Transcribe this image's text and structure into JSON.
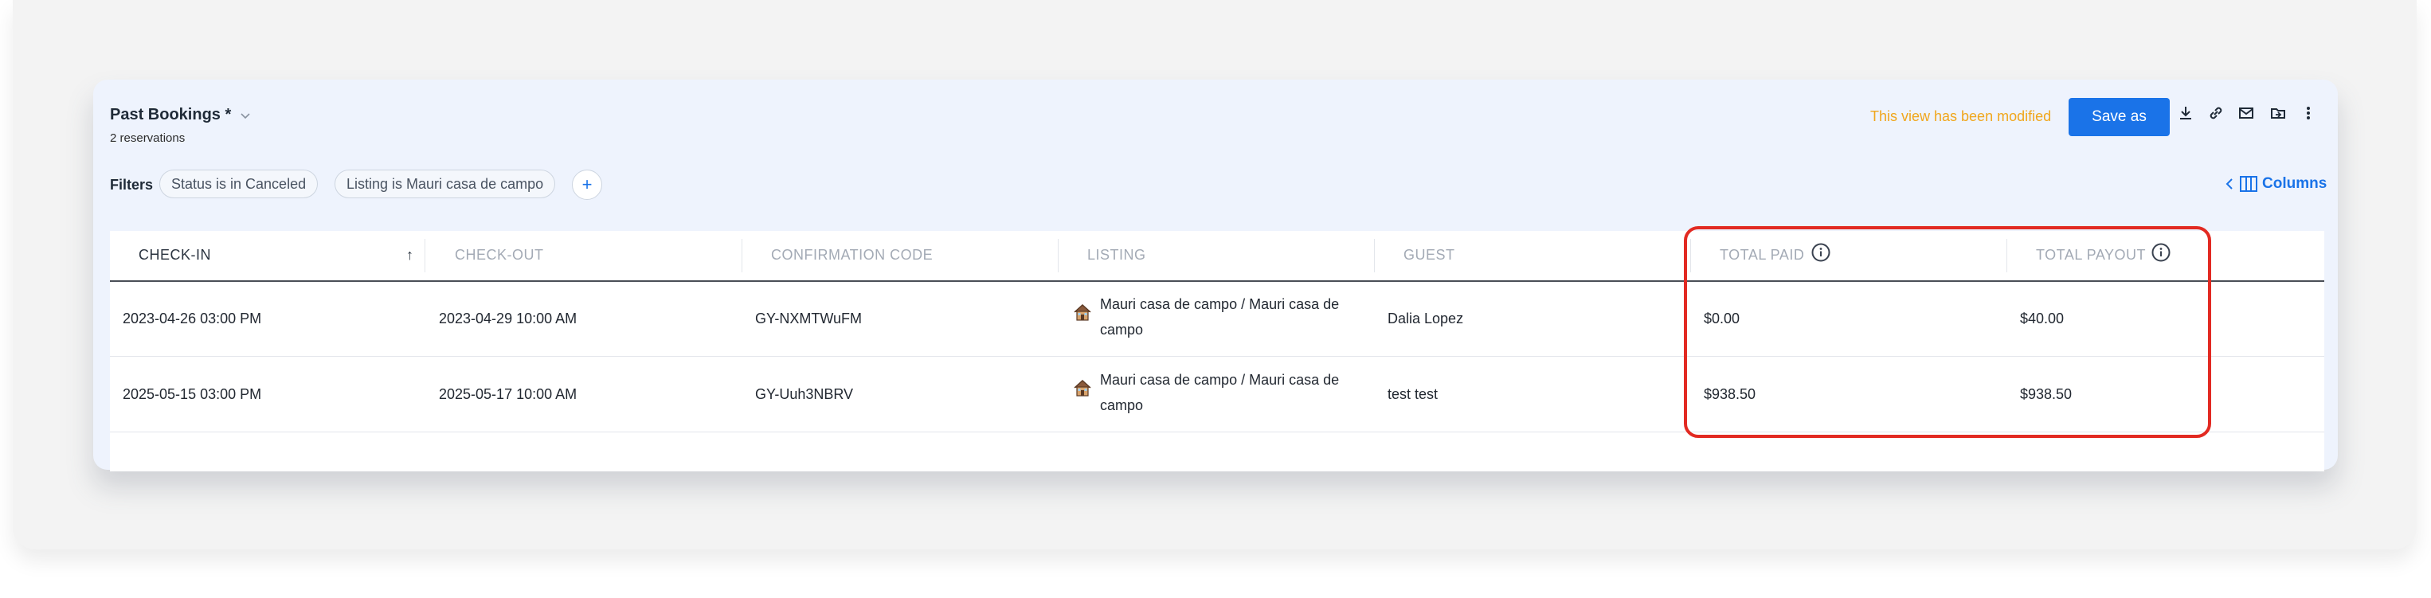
{
  "header": {
    "title": "Past Bookings *",
    "subtitle": "2 reservations",
    "modified_notice": "This view has been modified",
    "save_label": "Save as"
  },
  "toolbar_icons": [
    "download-icon",
    "link-icon",
    "mail-icon",
    "folder-export-icon",
    "more-vertical-icon"
  ],
  "filters": {
    "label": "Filters",
    "chips": [
      "Status is in Canceled",
      "Listing is Mauri casa de campo"
    ],
    "add_label": "+"
  },
  "columns_button": {
    "label": "Columns"
  },
  "table": {
    "headers": [
      "CHECK-IN",
      "CHECK-OUT",
      "CONFIRMATION CODE",
      "LISTING",
      "GUEST",
      "TOTAL PAID",
      "TOTAL PAYOUT"
    ],
    "sort": {
      "column": "CHECK-IN",
      "direction": "ascending",
      "glyph": "↑"
    },
    "rows": [
      {
        "check_in": "2023-04-26 03:00 PM",
        "check_out": "2023-04-29 10:00 AM",
        "confirmation_code": "GY-NXMTWuFM",
        "listing": "Mauri casa de campo / Mauri casa de campo",
        "guest": "Dalia Lopez",
        "total_paid": "$0.00",
        "total_payout": "$40.00"
      },
      {
        "check_in": "2025-05-15 03:00 PM",
        "check_out": "2025-05-17 10:00 AM",
        "confirmation_code": "GY-Uuh3NBRV",
        "listing": "Mauri casa de campo / Mauri casa de campo",
        "guest": "test test",
        "total_paid": "$938.50",
        "total_payout": "$938.50"
      }
    ]
  },
  "colors": {
    "accent": "#1a73e8",
    "modified_text": "#f0a61c",
    "highlight_border": "#e22a22",
    "card_background": "#eef3fd"
  }
}
